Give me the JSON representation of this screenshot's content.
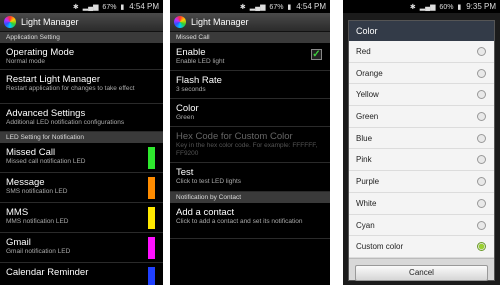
{
  "status_left": {
    "battery": "67%",
    "time": "4:54 PM"
  },
  "status_middle": {
    "battery": "67%",
    "time": "4:54 PM"
  },
  "status_right": {
    "battery": "60%",
    "time": "9:35 PM"
  },
  "app_title": "Light Manager",
  "screen1": {
    "section1": "Application Setting",
    "items": [
      {
        "title": "Operating Mode",
        "sub": "Normal mode"
      },
      {
        "title": "Restart Light Manager",
        "sub": "Restart application for changes to take effect"
      },
      {
        "title": "Advanced Settings",
        "sub": "Additional LED notification configurations"
      }
    ],
    "section2": "LED Setting for Notification",
    "led_items": [
      {
        "title": "Missed Call",
        "sub": "Missed call notification LED",
        "color": "#2ee82e"
      },
      {
        "title": "Message",
        "sub": "SMS notification LED",
        "color": "#ff8c00"
      },
      {
        "title": "MMS",
        "sub": "MMS notification LED",
        "color": "#ffe800"
      },
      {
        "title": "Gmail",
        "sub": "Gmail notification LED",
        "color": "#ff10ff"
      },
      {
        "title": "Calendar Reminder",
        "sub": "",
        "color": "#2040ff"
      }
    ]
  },
  "screen2": {
    "section1": "Missed Call",
    "items": [
      {
        "title": "Enable",
        "sub": "Enable LED light",
        "checked": true
      },
      {
        "title": "Flash Rate",
        "sub": "3 seconds"
      },
      {
        "title": "Color",
        "sub": "Green"
      },
      {
        "title": "Hex Code for Custom Color",
        "sub": "Key in the hex color code. For example: FFFFFF, FF9200"
      },
      {
        "title": "Test",
        "sub": "Click to test LED lights"
      }
    ],
    "section2": "Notification by Contact",
    "items2": [
      {
        "title": "Add a contact",
        "sub": "Click to add a contact and set its notification"
      }
    ]
  },
  "screen3": {
    "dialog_title": "Color",
    "options": [
      "Red",
      "Orange",
      "Yellow",
      "Green",
      "Blue",
      "Pink",
      "Purple",
      "White",
      "Cyan",
      "Custom color"
    ],
    "selected_index": 9,
    "cancel_label": "Cancel"
  }
}
